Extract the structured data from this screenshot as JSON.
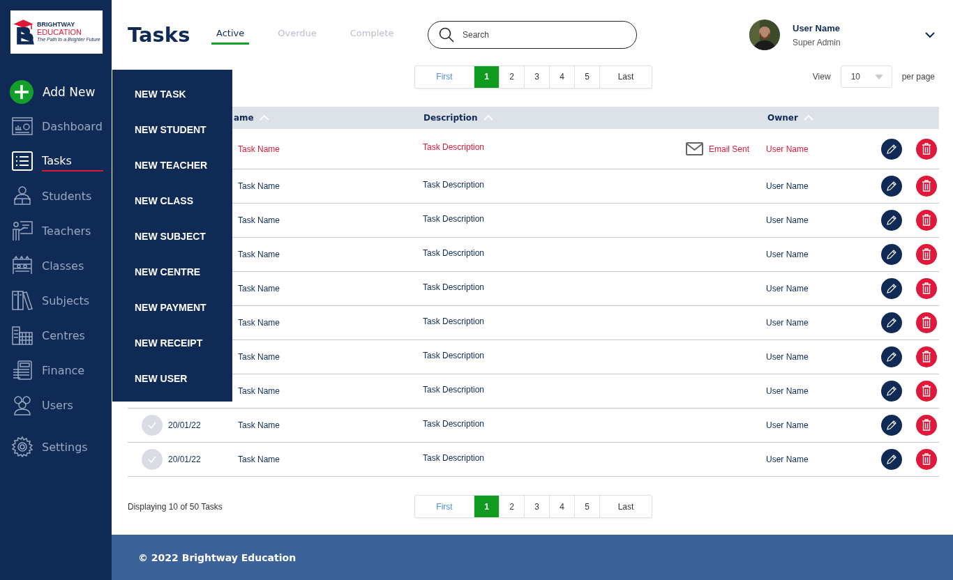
{
  "logo": {
    "line1": "BRIGHTWAY",
    "line2": "EDUCATION",
    "tagline": "The Path to a Brighter Future"
  },
  "sidebar": {
    "add_new": "Add New",
    "items": [
      {
        "label": "Dashboard",
        "selected": false
      },
      {
        "label": "Tasks",
        "selected": true
      },
      {
        "label": "Students",
        "selected": false
      },
      {
        "label": "Teachers",
        "selected": false
      },
      {
        "label": "Classes",
        "selected": false
      },
      {
        "label": "Subjects",
        "selected": false
      },
      {
        "label": "Centres",
        "selected": false
      },
      {
        "label": "Finance",
        "selected": false
      },
      {
        "label": "Users",
        "selected": false
      },
      {
        "label": "Settings",
        "selected": false
      }
    ]
  },
  "add_menu": [
    "NEW TASK",
    "NEW STUDENT",
    "NEW TEACHER",
    "NEW CLASS",
    "NEW SUBJECT",
    "NEW CENTRE",
    "NEW PAYMENT",
    "NEW RECEIPT",
    "NEW USER"
  ],
  "title": "Tasks",
  "tabs": [
    {
      "label": "Active",
      "selected": true
    },
    {
      "label": "Overdue",
      "selected": false
    },
    {
      "label": "Complete",
      "selected": false
    }
  ],
  "search": {
    "placeholder": "Search"
  },
  "user": {
    "name": "User Name",
    "role": "Super Admin"
  },
  "pagination_top": {
    "first": "First",
    "last": "Last",
    "pages": [
      {
        "label": "1",
        "selected": true
      },
      {
        "label": "2",
        "selected": false
      },
      {
        "label": "3",
        "selected": false
      },
      {
        "label": "4",
        "selected": false
      },
      {
        "label": "5",
        "selected": false
      }
    ]
  },
  "per_page": {
    "label": "View",
    "value": "10",
    "suffix": "per page"
  },
  "table": {
    "columns": [
      "ame",
      "Description",
      "Owner"
    ],
    "rows": [
      {
        "name": "Task Name",
        "description": "Task Description",
        "status": "Email Sent",
        "owner": "User Name",
        "highlighted": true
      },
      {
        "name": "Task Name",
        "description": "Task Description",
        "owner": "User Name",
        "highlighted": false
      },
      {
        "name": "Task Name",
        "description": "Task Description",
        "owner": "User Name",
        "highlighted": false
      },
      {
        "name": "Task Name",
        "description": "Task Description",
        "owner": "User Name",
        "highlighted": false
      },
      {
        "name": "Task Name",
        "description": "Task Description",
        "owner": "User Name",
        "highlighted": false
      },
      {
        "name": "Task Name",
        "description": "Task Description",
        "owner": "User Name",
        "highlighted": false
      },
      {
        "name": "Task Name",
        "description": "Task Description",
        "owner": "User Name",
        "highlighted": false
      },
      {
        "name": "Task Name",
        "description": "Task Description",
        "owner": "User Name",
        "highlighted": false
      },
      {
        "checked": false,
        "date": "20/01/22",
        "name": "Task Name",
        "description": "Task Description",
        "owner": "User Name",
        "highlighted": false
      },
      {
        "checked": false,
        "date": "20/01/22",
        "name": "Task Name",
        "description": "Task Description",
        "owner": "User Name",
        "highlighted": false
      }
    ]
  },
  "summary": "Displaying 10 of 50 Tasks",
  "pagination_bottom": {
    "first": "First",
    "last": "Last",
    "pages": [
      {
        "label": "1",
        "selected": true
      },
      {
        "label": "2",
        "selected": false
      },
      {
        "label": "3",
        "selected": false
      },
      {
        "label": "4",
        "selected": false
      },
      {
        "label": "5",
        "selected": false
      }
    ]
  },
  "footer": "© 2022 Brightway Education"
}
